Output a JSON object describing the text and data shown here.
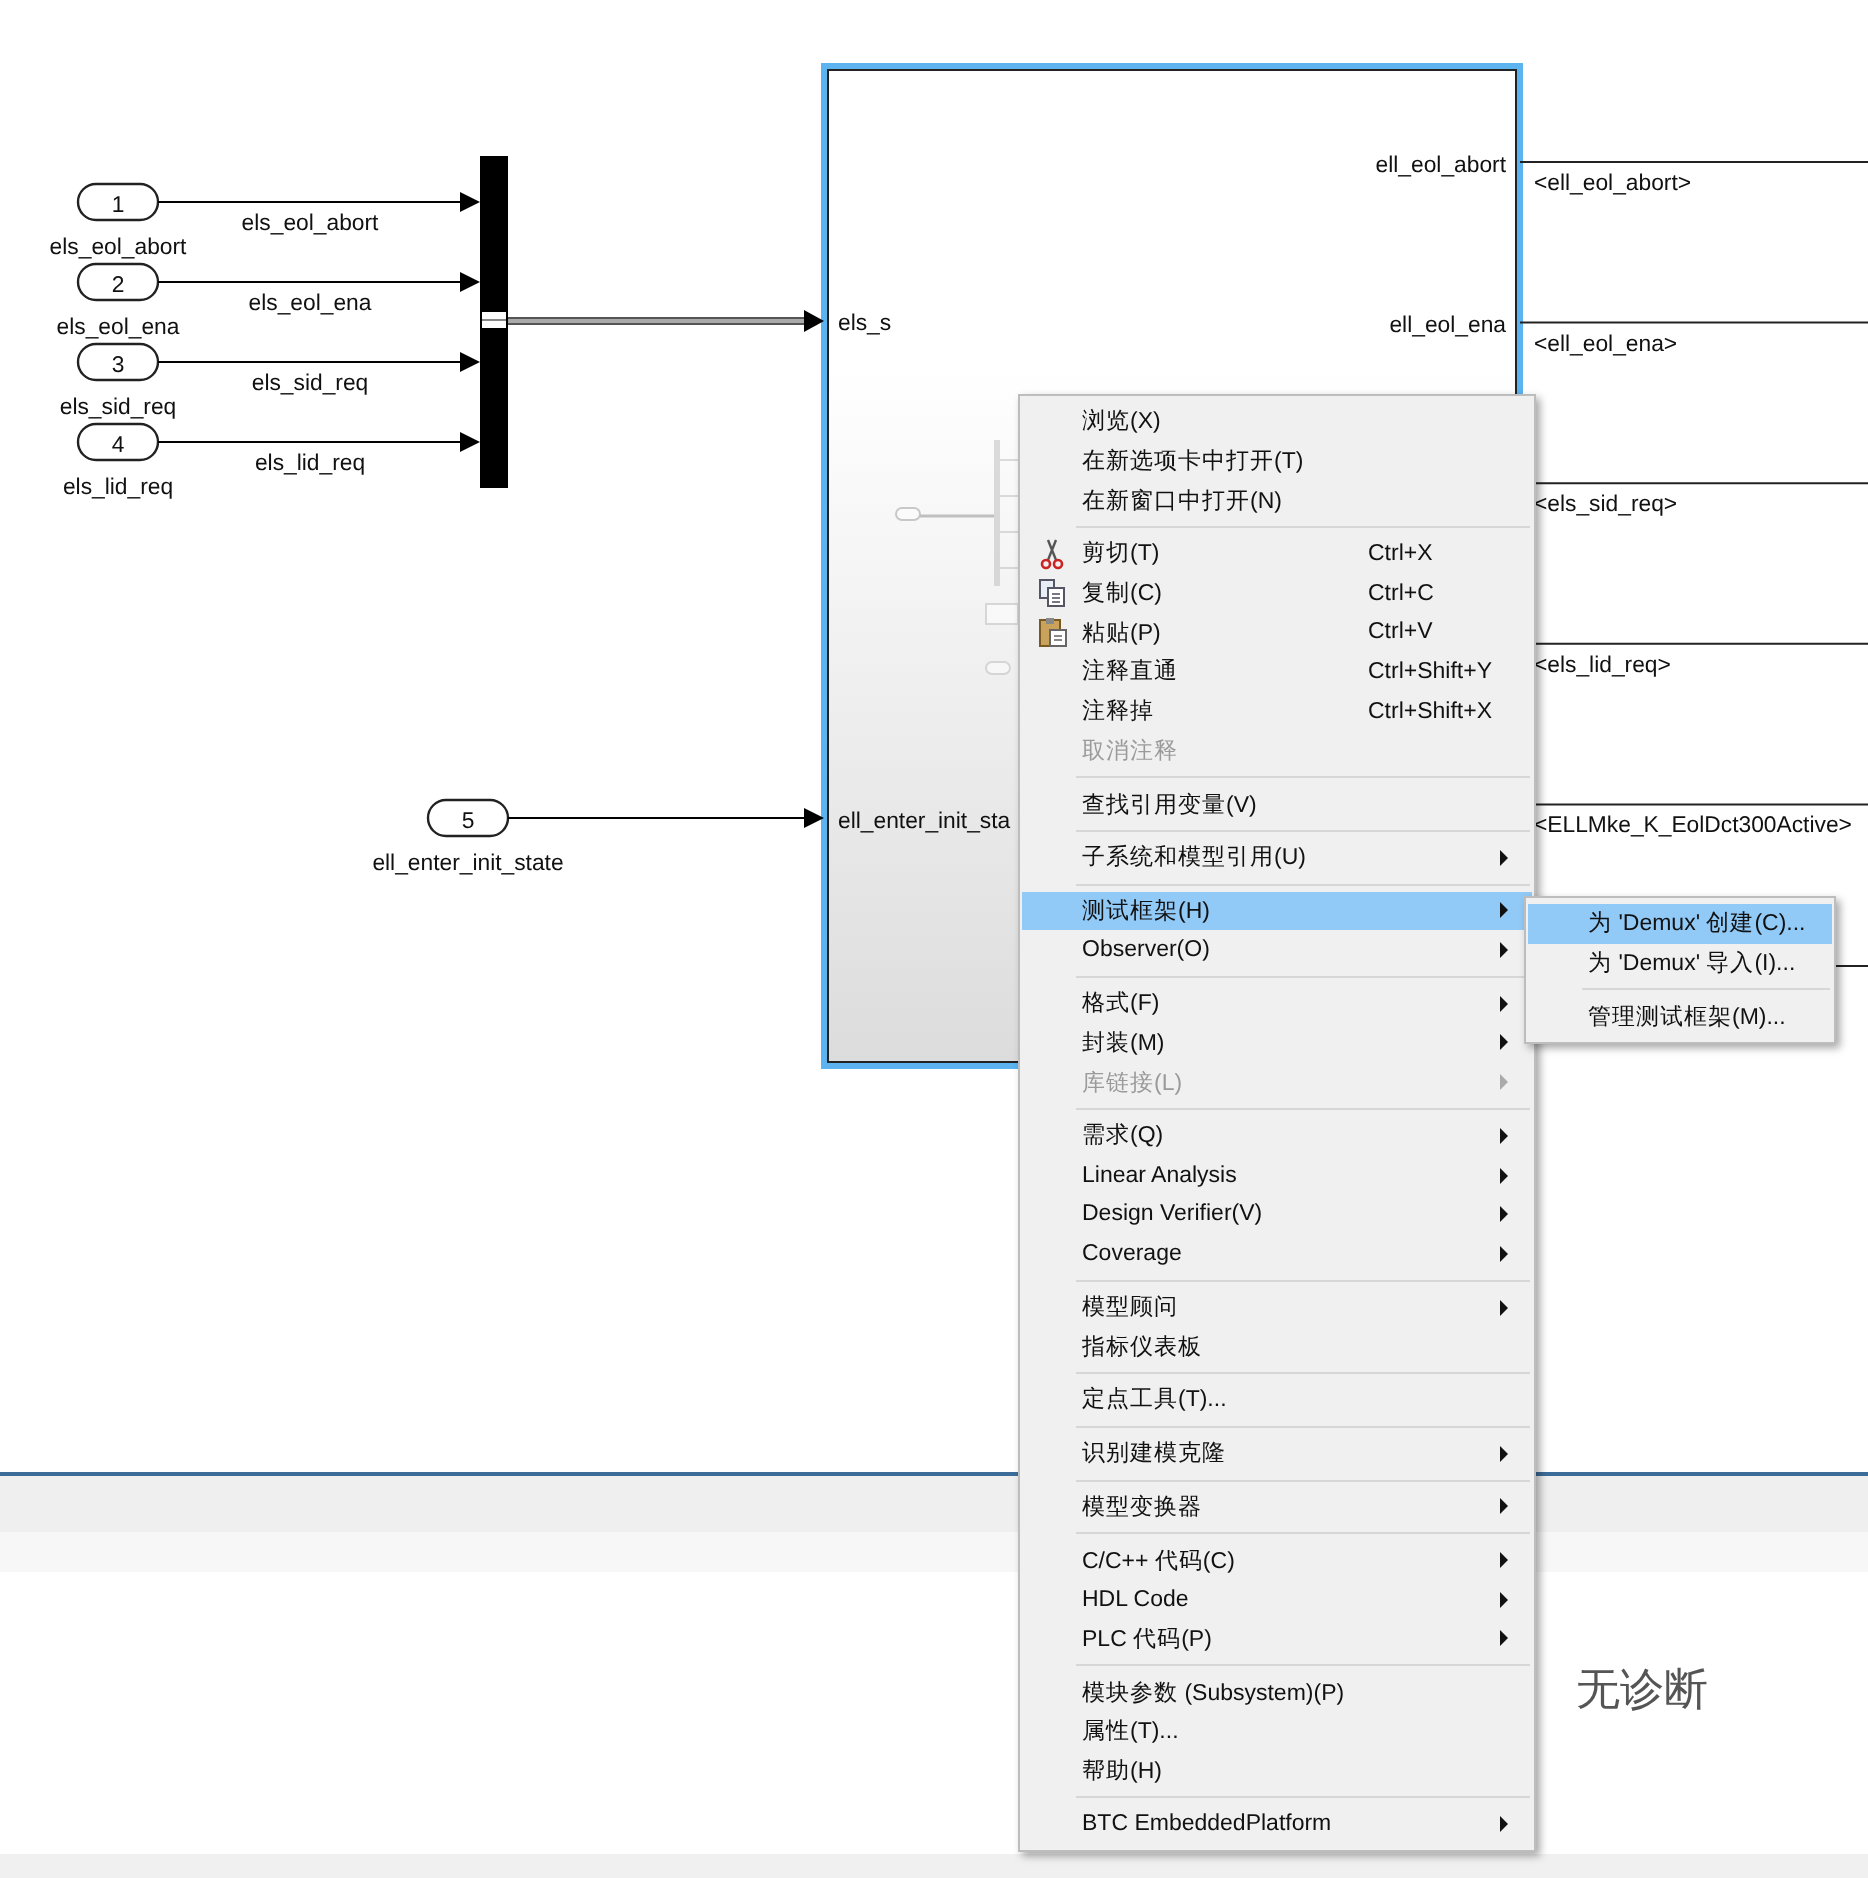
{
  "diagram": {
    "inports": [
      {
        "number": "1",
        "name": "els_eol_abort",
        "signal": "els_eol_abort"
      },
      {
        "number": "2",
        "name": "els_eol_ena",
        "signal": "els_eol_ena"
      },
      {
        "number": "3",
        "name": "els_sid_req",
        "signal": "els_sid_req"
      },
      {
        "number": "4",
        "name": "els_lid_req",
        "signal": "els_lid_req"
      },
      {
        "number": "5",
        "name": "ell_enter_init_state"
      }
    ],
    "subsystem": {
      "selected": true,
      "input_ports": [
        "els_s",
        "ell_enter_init_sta"
      ],
      "output_ports": [
        "ell_eol_abort",
        "ell_eol_ena"
      ]
    },
    "output_signals": [
      "<ell_eol_abort>",
      "<ell_eol_ena>",
      "<els_sid_req>",
      "<els_lid_req>",
      "<ELLMke_K_EolDct300Active>"
    ]
  },
  "diagnostics": {
    "message": "无诊断"
  },
  "context_menu": {
    "items": [
      {
        "kind": "item",
        "label": "浏览(X)",
        "disabled": false,
        "selected": false,
        "submenu": false
      },
      {
        "kind": "item",
        "label": "在新选项卡中打开(T)",
        "disabled": false,
        "selected": false,
        "submenu": false
      },
      {
        "kind": "item",
        "label": "在新窗口中打开(N)",
        "disabled": false,
        "selected": false,
        "submenu": false
      },
      {
        "kind": "separator"
      },
      {
        "kind": "edit_item",
        "label": "剪切(T)",
        "shortcut": "Ctrl+X",
        "disabled": false,
        "selected": false,
        "submenu": false
      },
      {
        "kind": "edit_item",
        "label": "复制(C)",
        "shortcut": "Ctrl+C",
        "disabled": false,
        "selected": false,
        "submenu": false
      },
      {
        "kind": "edit_item",
        "label": "粘贴(P)",
        "shortcut": "Ctrl+V",
        "disabled": false,
        "selected": false,
        "submenu": false
      },
      {
        "kind": "item",
        "label": "注释直通",
        "shortcut": "Ctrl+Shift+Y",
        "disabled": false,
        "selected": false,
        "submenu": false
      },
      {
        "kind": "item",
        "label": "注释掉",
        "shortcut": "Ctrl+Shift+X",
        "disabled": false,
        "selected": false,
        "submenu": false
      },
      {
        "kind": "item",
        "label": "取消注释",
        "disabled": true,
        "selected": false,
        "submenu": false
      },
      {
        "kind": "separator"
      },
      {
        "kind": "item",
        "label": "查找引用变量(V)",
        "disabled": false,
        "selected": false,
        "submenu": false
      },
      {
        "kind": "separator"
      },
      {
        "kind": "item",
        "label": "子系统和模型引用(U)",
        "disabled": false,
        "selected": false,
        "submenu": true
      },
      {
        "kind": "separator"
      },
      {
        "kind": "item",
        "label": "测试框架(H)",
        "disabled": false,
        "selected": true,
        "submenu": true
      },
      {
        "kind": "item",
        "label": "Observer(O)",
        "disabled": false,
        "selected": false,
        "submenu": true
      },
      {
        "kind": "separator"
      },
      {
        "kind": "item",
        "label": "格式(F)",
        "disabled": false,
        "selected": false,
        "submenu": true
      },
      {
        "kind": "item",
        "label": "封装(M)",
        "disabled": false,
        "selected": false,
        "submenu": true
      },
      {
        "kind": "item",
        "label": "库链接(L)",
        "disabled": true,
        "selected": false,
        "submenu": true
      },
      {
        "kind": "separator"
      },
      {
        "kind": "item",
        "label": "需求(Q)",
        "disabled": false,
        "selected": false,
        "submenu": true
      },
      {
        "kind": "item",
        "label": "Linear Analysis",
        "disabled": false,
        "selected": false,
        "submenu": true
      },
      {
        "kind": "item",
        "label": "Design Verifier(V)",
        "disabled": false,
        "selected": false,
        "submenu": true
      },
      {
        "kind": "item",
        "label": "Coverage",
        "disabled": false,
        "selected": false,
        "submenu": true
      },
      {
        "kind": "separator"
      },
      {
        "kind": "item",
        "label": "模型顾问",
        "disabled": false,
        "selected": false,
        "submenu": true
      },
      {
        "kind": "item",
        "label": "指标仪表板",
        "disabled": false,
        "selected": false,
        "submenu": false
      },
      {
        "kind": "separator"
      },
      {
        "kind": "item",
        "label": "定点工具(T)...",
        "disabled": false,
        "selected": false,
        "submenu": false
      },
      {
        "kind": "separator"
      },
      {
        "kind": "item",
        "label": "识别建模克隆",
        "disabled": false,
        "selected": false,
        "submenu": true
      },
      {
        "kind": "separator"
      },
      {
        "kind": "item",
        "label": "模型变换器",
        "disabled": false,
        "selected": false,
        "submenu": true
      },
      {
        "kind": "separator"
      },
      {
        "kind": "item",
        "label": "C/C++ 代码(C)",
        "disabled": false,
        "selected": false,
        "submenu": true
      },
      {
        "kind": "item",
        "label": "HDL Code",
        "disabled": false,
        "selected": false,
        "submenu": true
      },
      {
        "kind": "item",
        "label": "PLC 代码(P)",
        "disabled": false,
        "selected": false,
        "submenu": true
      },
      {
        "kind": "separator"
      },
      {
        "kind": "item",
        "label": "模块参数 (Subsystem)(P)",
        "disabled": false,
        "selected": false,
        "submenu": false
      },
      {
        "kind": "item",
        "label": "属性(T)...",
        "disabled": false,
        "selected": false,
        "submenu": false
      },
      {
        "kind": "item",
        "label": "帮助(H)",
        "disabled": false,
        "selected": false,
        "submenu": false
      },
      {
        "kind": "separator"
      },
      {
        "kind": "item",
        "label": "BTC EmbeddedPlatform",
        "disabled": false,
        "selected": false,
        "submenu": true
      }
    ]
  },
  "submenu": {
    "items": [
      {
        "kind": "item",
        "label": "为 'Demux' 创建(C)...",
        "selected": true
      },
      {
        "kind": "item",
        "label": "为 'Demux' 导入(I)...",
        "selected": false
      },
      {
        "kind": "separator"
      },
      {
        "kind": "item",
        "label": "管理测试框架(M)...",
        "selected": false
      }
    ]
  }
}
